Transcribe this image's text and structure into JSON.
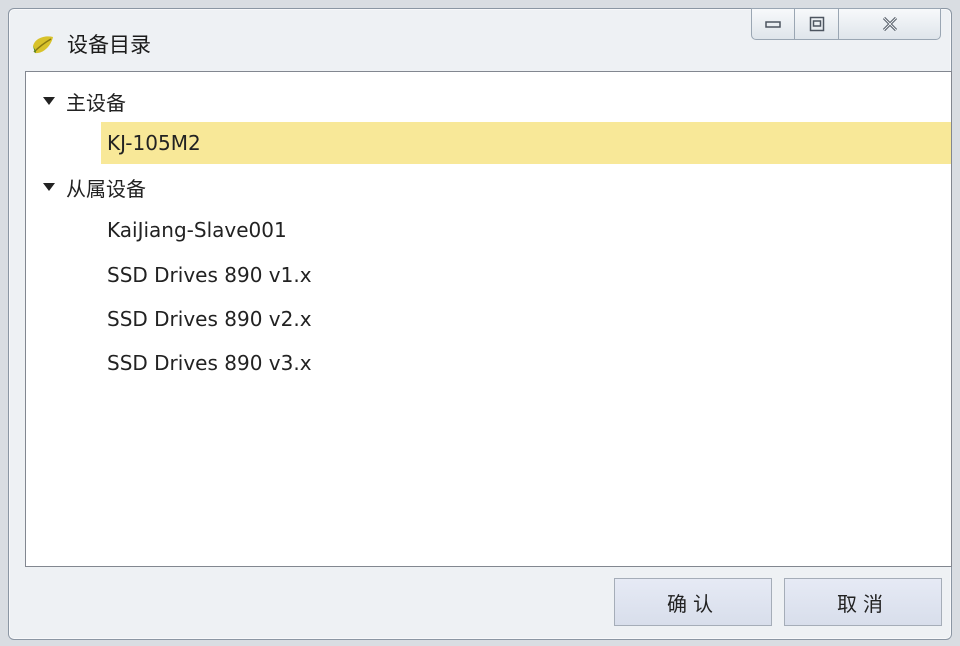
{
  "window": {
    "title": "设备目录",
    "icon": "app-leaf-icon",
    "caption_buttons": [
      "minimize-icon",
      "maximize-icon",
      "close-icon"
    ]
  },
  "tree": {
    "groups": [
      {
        "label": "主设备",
        "expanded": true,
        "items": [
          {
            "label": "KJ-105M2",
            "selected": true
          }
        ]
      },
      {
        "label": "从属设备",
        "expanded": true,
        "items": [
          {
            "label": "KaiJiang-Slave001",
            "selected": false
          },
          {
            "label": "SSD Drives 890 v1.x",
            "selected": false
          },
          {
            "label": "SSD Drives 890 v2.x",
            "selected": false
          },
          {
            "label": "SSD Drives 890 v3.x",
            "selected": false
          }
        ]
      }
    ]
  },
  "buttons": {
    "ok": "确认",
    "cancel": "取消"
  },
  "colors": {
    "selection": "#f8e898",
    "button_bg": "#dfe4f0"
  }
}
